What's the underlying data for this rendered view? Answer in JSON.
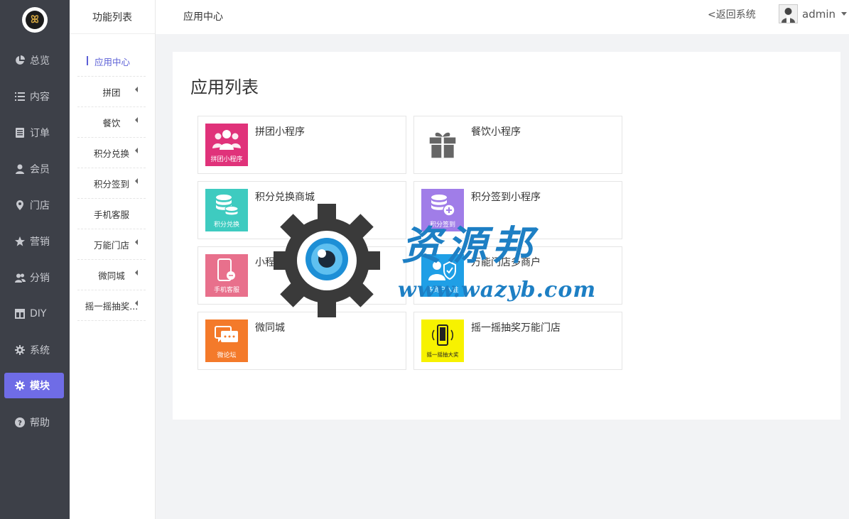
{
  "sidebar": {
    "items": [
      {
        "label": "总览",
        "icon": "pie-chart-icon"
      },
      {
        "label": "内容",
        "icon": "list-icon"
      },
      {
        "label": "订单",
        "icon": "document-icon"
      },
      {
        "label": "会员",
        "icon": "user-icon"
      },
      {
        "label": "门店",
        "icon": "map-pin-icon"
      },
      {
        "label": "营销",
        "icon": "star-icon"
      },
      {
        "label": "分销",
        "icon": "users-icon"
      },
      {
        "label": "DIY",
        "icon": "layout-icon"
      },
      {
        "label": "系统",
        "icon": "gear-icon"
      },
      {
        "label": "模块",
        "icon": "gear-icon",
        "active": true
      },
      {
        "label": "帮助",
        "icon": "help-icon"
      }
    ],
    "active_color": "#6f6ce6"
  },
  "subnav": {
    "title": "功能列表",
    "items": [
      {
        "label": "应用中心",
        "current": true
      },
      {
        "label": "拼团"
      },
      {
        "label": "餐饮"
      },
      {
        "label": "积分兑换"
      },
      {
        "label": "积分签到"
      },
      {
        "label": "手机客服"
      },
      {
        "label": "万能门店"
      },
      {
        "label": "微同城"
      },
      {
        "label": "摇一摇抽奖..."
      }
    ]
  },
  "header": {
    "title": "应用中心",
    "back_label": "<返回系统",
    "username": "admin"
  },
  "main": {
    "title": "应用列表",
    "apps": [
      {
        "name": "拼团小程序",
        "tile_label": "拼团小程序",
        "color": "#e0327a",
        "icon": "group-icon"
      },
      {
        "name": "餐饮小程序",
        "tile_label": "",
        "color": "#ffffff",
        "icon": "gift-icon"
      },
      {
        "name": "积分兑换商城",
        "tile_label": "积分兑换",
        "color": "#3ecbc0",
        "icon": "database-icon"
      },
      {
        "name": "积分签到小程序",
        "tile_label": "积分签到",
        "color": "#a07de8",
        "icon": "database-plus-icon"
      },
      {
        "name": "小程序手机客服",
        "tile_label": "手机客服",
        "color": "#e8708c",
        "icon": "phone-chat-icon"
      },
      {
        "name": "万能门店多商户",
        "tile_label": "多商户入驻",
        "color": "#1f9fe6",
        "icon": "merchant-shield-icon"
      },
      {
        "name": "微同城",
        "tile_label": "微论坛",
        "color": "#f47a2a",
        "icon": "chat-bubbles-icon"
      },
      {
        "name": "摇一摇抽奖万能门店",
        "tile_label": "摇一摇抽大奖",
        "color": "#f7f200",
        "icon": "shaking-phone-icon"
      }
    ]
  },
  "watermark": {
    "text": "资源邦",
    "url": "www.wazyb.com"
  }
}
